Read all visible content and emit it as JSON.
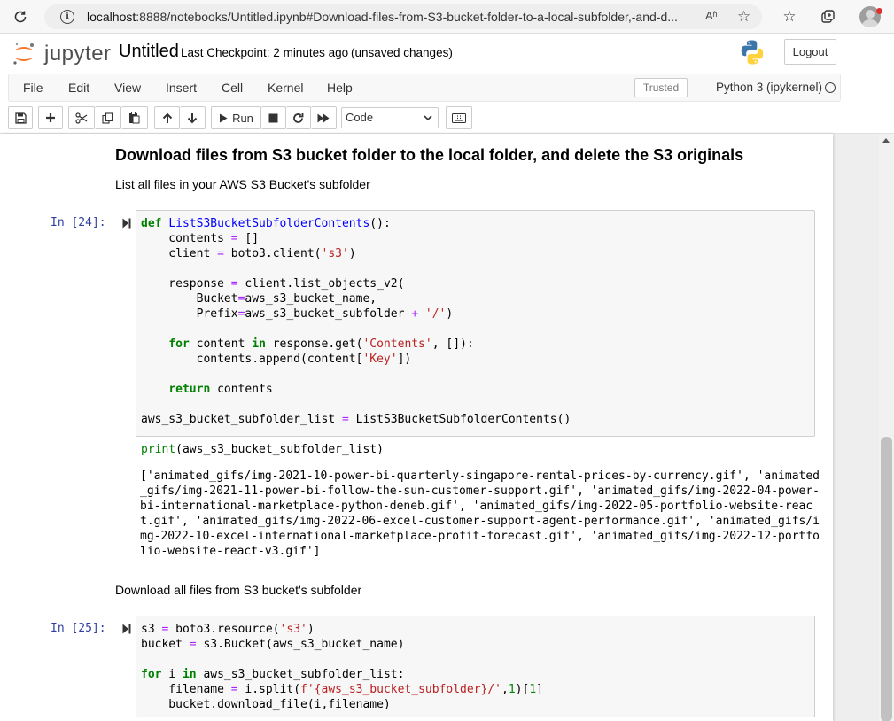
{
  "browser": {
    "url_host": "localhost",
    "url_rest": ":8888/notebooks/Untitled.ipynb#Download-files-from-S3-bucket-folder-to-a-local-subfolder,-and-d...",
    "read_aloud_label": "Aʱ"
  },
  "header": {
    "logo_text": "jupyter",
    "notebook_title": "Untitled",
    "checkpoint": "Last Checkpoint: 2 minutes ago",
    "save_status": "(unsaved changes)",
    "logout_label": "Logout"
  },
  "menubar": {
    "items": [
      "File",
      "Edit",
      "View",
      "Insert",
      "Cell",
      "Kernel",
      "Help"
    ],
    "trusted_label": "Trusted",
    "kernel_name": "Python 3 (ipykernel)"
  },
  "toolbar": {
    "run_label": "Run",
    "cell_type": "Code"
  },
  "notebook": {
    "heading": "Download files from S3 bucket folder to the local folder, and delete the S3 originals",
    "md1": "List all files in your AWS S3 Bucket's subfolder",
    "cell1_prompt": "In [24]:",
    "cell1_code": [
      "def ListS3BucketSubfolderContents():",
      "    contents = []",
      "    client = boto3.client('s3')",
      "",
      "    response = client.list_objects_v2(",
      "        Bucket=aws_s3_bucket_name,",
      "        Prefix=aws_s3_bucket_subfolder + '/')",
      "",
      "    for content in response.get('Contents', []):",
      "        contents.append(content['Key'])",
      "",
      "    return contents",
      "",
      "aws_s3_bucket_subfolder_list = ListS3BucketSubfolderContents()",
      "",
      "print(aws_s3_bucket_subfolder_list)"
    ],
    "cell1_output": [
      "['animated_gifs/img-2021-10-power-bi-quarterly-singapore-rental-prices-by-currency.gif', 'animated",
      "_gifs/img-2021-11-power-bi-follow-the-sun-customer-support.gif', 'animated_gifs/img-2022-04-power-",
      "bi-international-marketplace-python-deneb.gif', 'animated_gifs/img-2022-05-portfolio-website-reac",
      "t.gif', 'animated_gifs/img-2022-06-excel-customer-support-agent-performance.gif', 'animated_gifs/i",
      "mg-2022-10-excel-international-marketplace-profit-forecast.gif', 'animated_gifs/img-2022-12-portfo",
      "lio-website-react-v3.gif']"
    ],
    "md2": "Download all files from S3 bucket's subfolder",
    "cell2_prompt": "In [25]:",
    "cell2_code": [
      "s3 = boto3.resource('s3')",
      "bucket = s3.Bucket(aws_s3_bucket_name)",
      "",
      "for i in aws_s3_bucket_subfolder_list:",
      "    filename = i.split(f'{aws_s3_bucket_subfolder}/',1)[1]",
      "    bucket.download_file(i,filename)"
    ]
  },
  "colors": {
    "prompt": "#303f9f",
    "keyword": "#008000",
    "string": "#ba2121",
    "function": "#0000ff",
    "operator": "#aa22ff"
  }
}
